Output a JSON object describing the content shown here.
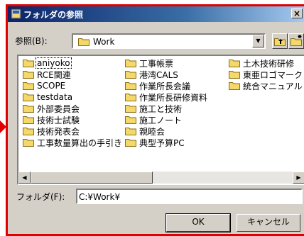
{
  "window": {
    "title": "フォルダの参照",
    "close_glyph": "×"
  },
  "lookin": {
    "label": "参照(B):",
    "value": "Work"
  },
  "folders": {
    "col1": [
      "aniyoko",
      "RCE関連",
      "SCOPE",
      "testdata",
      "外部委員会",
      "技術士試験",
      "技術発表会",
      "工事数量算出の手引き"
    ],
    "col2": [
      "工事帳票",
      "港湾CALS",
      "作業所長会議",
      "作業所長研修資料",
      "施工と技術",
      "施工ノート",
      "親睦会",
      "典型予算PC"
    ],
    "col3": [
      "土木技術研修",
      "東亜ロゴマーク",
      "統合マニュアル"
    ]
  },
  "scrollbar": {
    "left_glyph": "◀",
    "right_glyph": "▶"
  },
  "folder_field": {
    "label": "フォルダ(F):",
    "value": "C:¥Work¥"
  },
  "buttons": {
    "ok": "OK",
    "cancel": "キャンセル"
  },
  "colors": {
    "selection": "#000000",
    "folder": "#f5d86a",
    "accent": "#e00000"
  }
}
